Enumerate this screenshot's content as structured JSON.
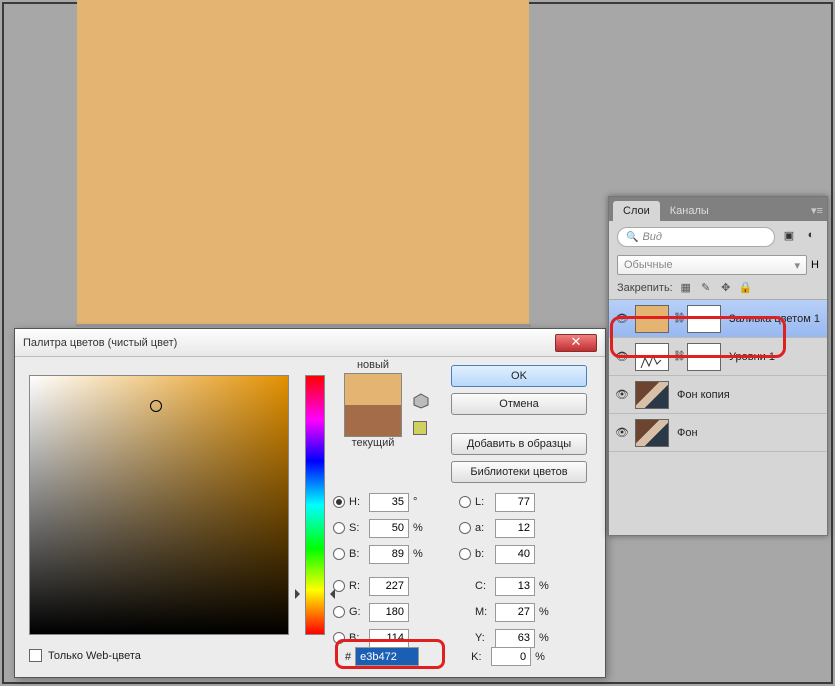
{
  "canvas_color": "#e3b472",
  "dialog": {
    "title": "Палитра цветов (чистый цвет)",
    "new_label": "новый",
    "current_label": "текущий",
    "buttons": {
      "ok": "OK",
      "cancel": "Отмена",
      "add": "Добавить в образцы",
      "libraries": "Библиотеки цветов"
    },
    "hsb": {
      "h": "35",
      "s": "50",
      "b": "89"
    },
    "rgb": {
      "r": "227",
      "g": "180",
      "b": "114"
    },
    "lab": {
      "l": "77",
      "a": "12",
      "b2": "40"
    },
    "cmyk": {
      "c": "13",
      "m": "27",
      "y": "63",
      "k": "0"
    },
    "hex": "e3b472",
    "webonly": "Только Web-цвета",
    "deg": "°",
    "pct": "%",
    "labels": {
      "H": "H:",
      "S": "S:",
      "B": "B:",
      "R": "R:",
      "G": "G:",
      "B2": "B:",
      "L": "L:",
      "a": "a:",
      "b": "b:",
      "C": "C:",
      "M": "M:",
      "Y": "Y:",
      "K": "K:"
    }
  },
  "panel": {
    "tabs": {
      "layers": "Слои",
      "channels": "Каналы"
    },
    "search_placeholder": "Вид",
    "blend_mode": "Обычные",
    "opacity_label": "Н",
    "lock_label": "Закрепить:",
    "layers": [
      {
        "name": "Заливка цветом 1"
      },
      {
        "name": "Уровни 1"
      },
      {
        "name": "Фон копия"
      },
      {
        "name": "Фон"
      }
    ]
  }
}
